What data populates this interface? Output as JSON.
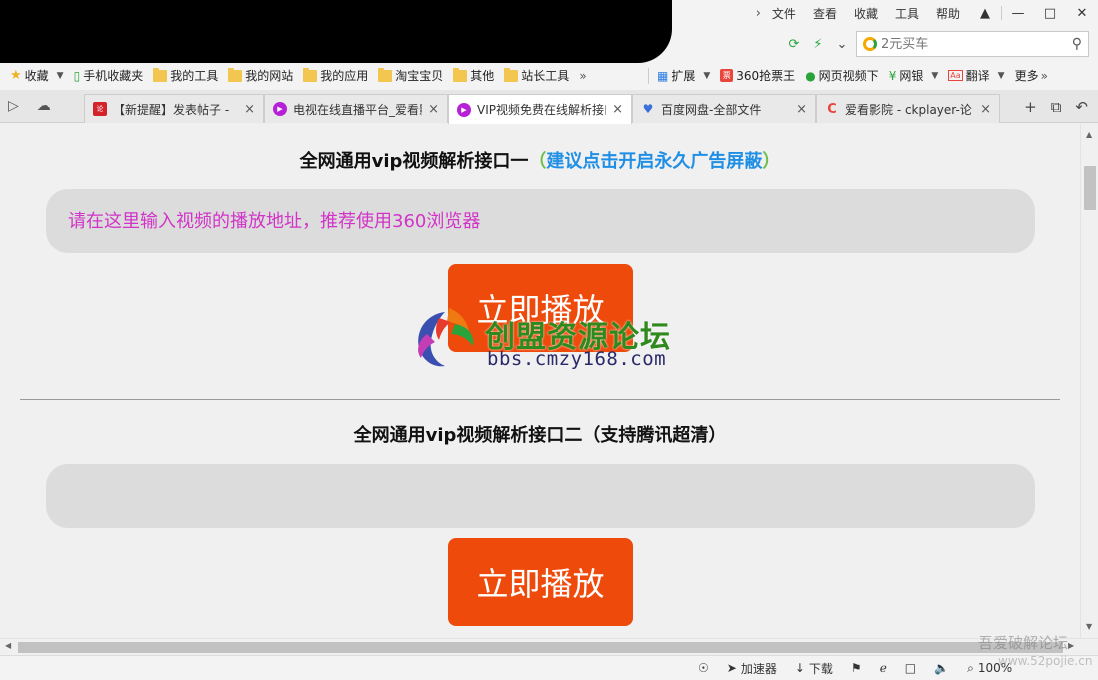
{
  "menu": {
    "items": [
      "文件",
      "查看",
      "收藏",
      "工具",
      "帮助"
    ]
  },
  "search": {
    "placeholder": "2元买车"
  },
  "bookmarks": {
    "left": [
      "收藏",
      "手机收藏夹",
      "我的工具",
      "我的网站",
      "我的应用",
      "淘宝宝贝",
      "其他",
      "站长工具"
    ],
    "right": [
      "扩展",
      "360抢票王",
      "网页视频下",
      "网银",
      "翻译",
      "更多"
    ]
  },
  "tabs": [
    {
      "title": "【新提醒】发表帖子 -",
      "color": "#d2232a"
    },
    {
      "title": "电视在线直播平台_爱看影",
      "color": "#b620d6"
    },
    {
      "title": "VIP视频免费在线解析接口",
      "color": "#b620d6"
    },
    {
      "title": "百度网盘-全部文件",
      "color": "#3b6fd9"
    },
    {
      "title": "爱看影院 - ckplayer-论",
      "color": "#e8453c"
    }
  ],
  "page": {
    "section1": {
      "title": "全网通用vip视频解析接口一",
      "paren_open": "（",
      "hint": "建议点击开启永久广告屏蔽",
      "paren_close": "）",
      "input_placeholder": "请在这里输入视频的播放地址，推荐使用360浏览器",
      "button": "立即播放"
    },
    "section2": {
      "title": "全网通用vip视频解析接口二（支持腾讯超清）",
      "button": "立即播放"
    },
    "watermark": {
      "text": "创盟资源论坛",
      "url": "bbs.cmzy168.com"
    }
  },
  "status": {
    "accelerator": "加速器",
    "download": "下载",
    "zoom": "100%"
  },
  "overlay_watermark": {
    "line1": "吾爱破解论坛",
    "line2": "www.52pojie.cn"
  },
  "colors": {
    "play_button": "#ee4a0b",
    "input_text": "#d233c8",
    "hint_text": "#1f8fe6",
    "hint_paren": "#6ac04a"
  }
}
